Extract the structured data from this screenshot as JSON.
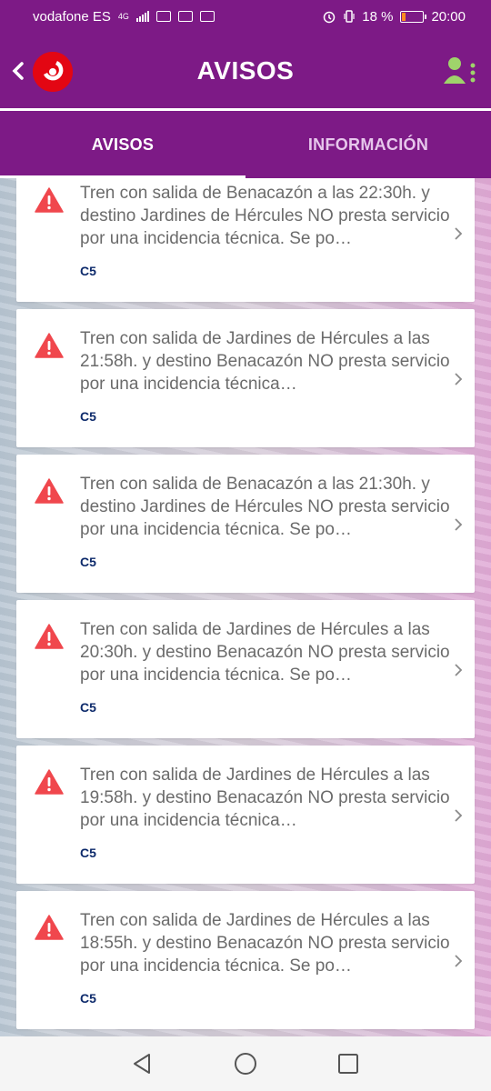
{
  "status_bar": {
    "carrier": "vodafone ES",
    "network": "4G",
    "battery_percent": "18 %",
    "battery_level": 0.18,
    "time": "20:00"
  },
  "header": {
    "title": "AVISOS",
    "brand_color": "#7d1a86",
    "logo_color": "#e30613"
  },
  "tabs": [
    {
      "label": "AVISOS",
      "active": true
    },
    {
      "label": "INFORMACIÓN",
      "active": false
    }
  ],
  "alerts": [
    {
      "text": "Tren con salida de Benacazón a las 22:30h. y destino Jardines de Hércules NO presta servicio por una incidencia técnica. Se po…",
      "line": "C5"
    },
    {
      "text": "Tren con salida de Jardines de Hércules a las 21:58h. y destino Benacazón NO presta servicio por una incidencia técnica…",
      "line": "C5"
    },
    {
      "text": "Tren con salida de Benacazón a las 21:30h. y destino Jardines de Hércules NO presta servicio por una incidencia técnica. Se po…",
      "line": "C5"
    },
    {
      "text": "Tren con salida de Jardines de Hércules a las 20:30h. y destino Benacazón NO presta servicio por una incidencia técnica. Se po…",
      "line": "C5"
    },
    {
      "text": "Tren con salida de Jardines de Hércules a las 19:58h. y destino Benacazón NO presta servicio por una incidencia técnica…",
      "line": "C5"
    },
    {
      "text": "Tren con salida de Jardines de Hércules a las 18:55h. y destino Benacazón NO presta servicio por una incidencia técnica. Se po…",
      "line": "C5"
    }
  ],
  "icons": {
    "alert": "warning-triangle-icon",
    "chevron": "chevron-right-icon",
    "user": "user-menu-icon",
    "back": "chevron-left-icon"
  },
  "alert_color": "#f0474d"
}
